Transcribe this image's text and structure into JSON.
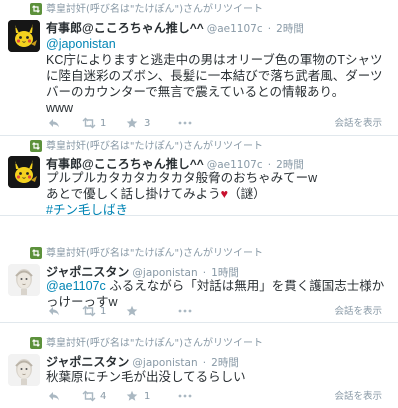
{
  "tweets": [
    {
      "retweeted_by": "尊皇討奸(呼び名は\"たけぽん\")さんがリツイート",
      "name": "有事郎@こころちゃん推し^^",
      "handle": "@ae1107c",
      "dot": "·",
      "time": "2時間",
      "reply_to": "@japonistan",
      "text": "KC庁によりますと逃走中の男はオリーブ色の軍物のTシャツに陸自迷彩のズボン、長髪に一本結びで落ち武者風、ダーツバーのカウンターで無言で震えているとの情報あり。",
      "text2": "www",
      "retweets": "1",
      "favorites": "3",
      "expand": "会話を表示"
    },
    {
      "retweeted_by": "尊皇討奸(呼び名は\"たけぽん\")さんがリツイート",
      "name": "有事郎@こころちゃん推し^^",
      "handle": "@ae1107c",
      "dot": "·",
      "time": "2時間",
      "line1": "プルプルカタカタカタカタ般脅のおちゃみてーw",
      "line2a": "あとで優しく話し掛けてみよう",
      "heart": "♥",
      "line2b": "（謎）",
      "hashtag": "#チン毛しばき"
    },
    {
      "retweeted_by": "尊皇討奸(呼び名は\"たけぽん\")さんがリツイート",
      "name": "ジャポニスタン",
      "handle": "@japonistan",
      "dot": "·",
      "time": "1時間",
      "reply_to": "@ae1107c",
      "text": " ふるえながら「対話は無用」を貫く護国志士様かっけーっすw",
      "retweets": "1",
      "expand": "会話を表示"
    },
    {
      "retweeted_by": "尊皇討奸(呼び名は\"たけぽん\")さんがリツイート",
      "name": "ジャポニスタン",
      "handle": "@japonistan",
      "dot": "·",
      "time": "2時間",
      "text": "秋葉原にチン毛が出没してるらしい",
      "retweets": "4",
      "favorites": "1",
      "expand": "会話を表示"
    }
  ],
  "icons": {
    "retweet_context": "retweet-icon",
    "reply": "reply-icon",
    "retweet": "retweet-icon",
    "favorite": "star-icon",
    "more": "more-icon"
  },
  "colors": {
    "link": "#0084b4",
    "retweet_green": "#5c913b",
    "muted": "#8899a6",
    "heart": "#c8102e"
  }
}
